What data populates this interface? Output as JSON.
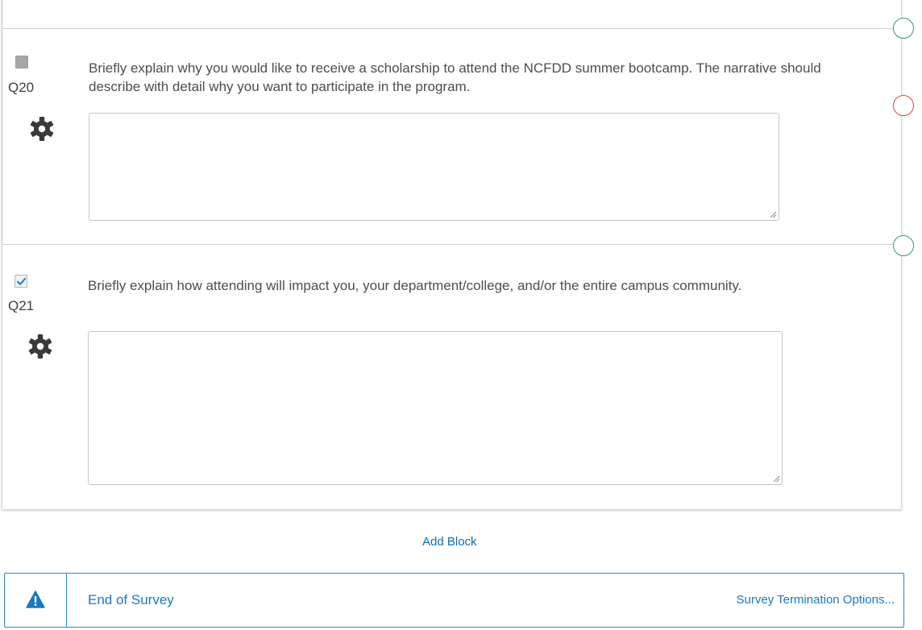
{
  "questions": [
    {
      "id": "Q20",
      "selected": false,
      "text": "Briefly explain why you would like to receive a scholarship to attend the NCFDD summer bootcamp. The narrative should describe with detail why you want to participate in the program.",
      "icons": {
        "settings": "gear-icon",
        "resize": "resize-handle-icon"
      }
    },
    {
      "id": "Q21",
      "selected": true,
      "text": "Briefly explain how attending will impact you, your department/college, and/or the entire campus community.",
      "icons": {
        "settings": "gear-icon",
        "resize": "resize-handle-icon"
      }
    }
  ],
  "add_block_label": "Add Block",
  "end_of_survey": {
    "title": "End of Survey",
    "options_label": "Survey Termination Options...",
    "icon": "warning-icon"
  },
  "colors": {
    "link": "#0b6bb5",
    "end_of_survey_border": "#2a89c8",
    "checkbox_check": "#2a89c8",
    "ring_green": "#2e9e6a",
    "ring_red": "#d64545"
  }
}
